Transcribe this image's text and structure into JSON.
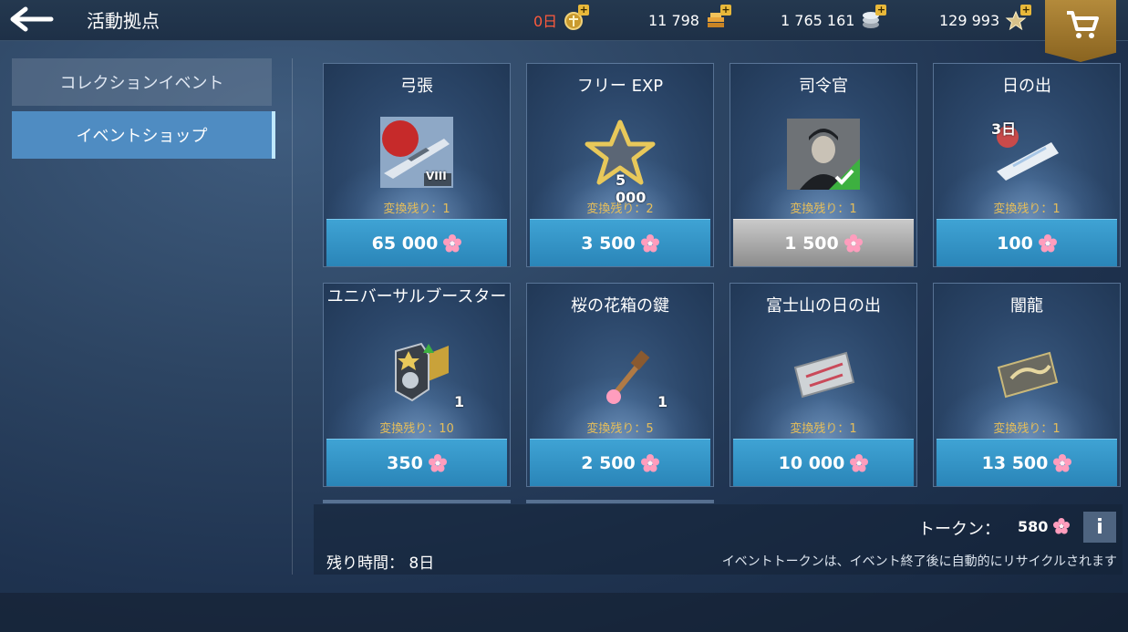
{
  "header": {
    "title": "活動拠点",
    "days": "0日",
    "currencies": [
      {
        "value": "11 798",
        "icon": "gold-bars-icon"
      },
      {
        "value": "1 765 161",
        "icon": "silver-icon"
      },
      {
        "value": "129 993",
        "icon": "free-exp-star-icon"
      }
    ]
  },
  "sidebar": {
    "items": [
      {
        "label": "コレクションイベント",
        "active": false
      },
      {
        "label": "イベントショップ",
        "active": true
      }
    ]
  },
  "cards": [
    {
      "name": "弓張",
      "remain": "変換残り：1",
      "price": "65 000",
      "icon": "ship-icon",
      "badge": "VIII"
    },
    {
      "name": "フリー EXP",
      "remain": "変換残り：2",
      "price": "3 500",
      "icon": "star-icon",
      "qty": "5 000"
    },
    {
      "name": "司令官",
      "remain": "変換残り：1",
      "price": "1 500",
      "icon": "commander-portrait-icon",
      "owned": true
    },
    {
      "name": "日の出",
      "remain": "変換残り：1",
      "price": "100",
      "icon": "flag-icon",
      "qty": "3日"
    },
    {
      "name": "ユニバーサルブースター",
      "remain": "変換残り：10",
      "price": "350",
      "icon": "booster-icon",
      "qty": "1"
    },
    {
      "name": "桜の花箱の鍵",
      "remain": "変換残り：5",
      "price": "2 500",
      "icon": "key-icon",
      "qty": "1"
    },
    {
      "name": "富士山の日の出",
      "remain": "変換残り：1",
      "price": "10 000",
      "icon": "camouflage-icon"
    },
    {
      "name": "闇龍",
      "remain": "変換残り：1",
      "price": "13 500",
      "icon": "dragon-camo-icon"
    }
  ],
  "bottom": {
    "token_label": "トークン：",
    "token_value": "580",
    "time_left": "残り時間： 8日",
    "recycle_note": "イベントトークンは、イベント終了後に自動的にリサイクルされます"
  },
  "colors": {
    "accent": "#3fa3d4",
    "gold": "#e6be5a",
    "days": "#ff5a3c"
  }
}
